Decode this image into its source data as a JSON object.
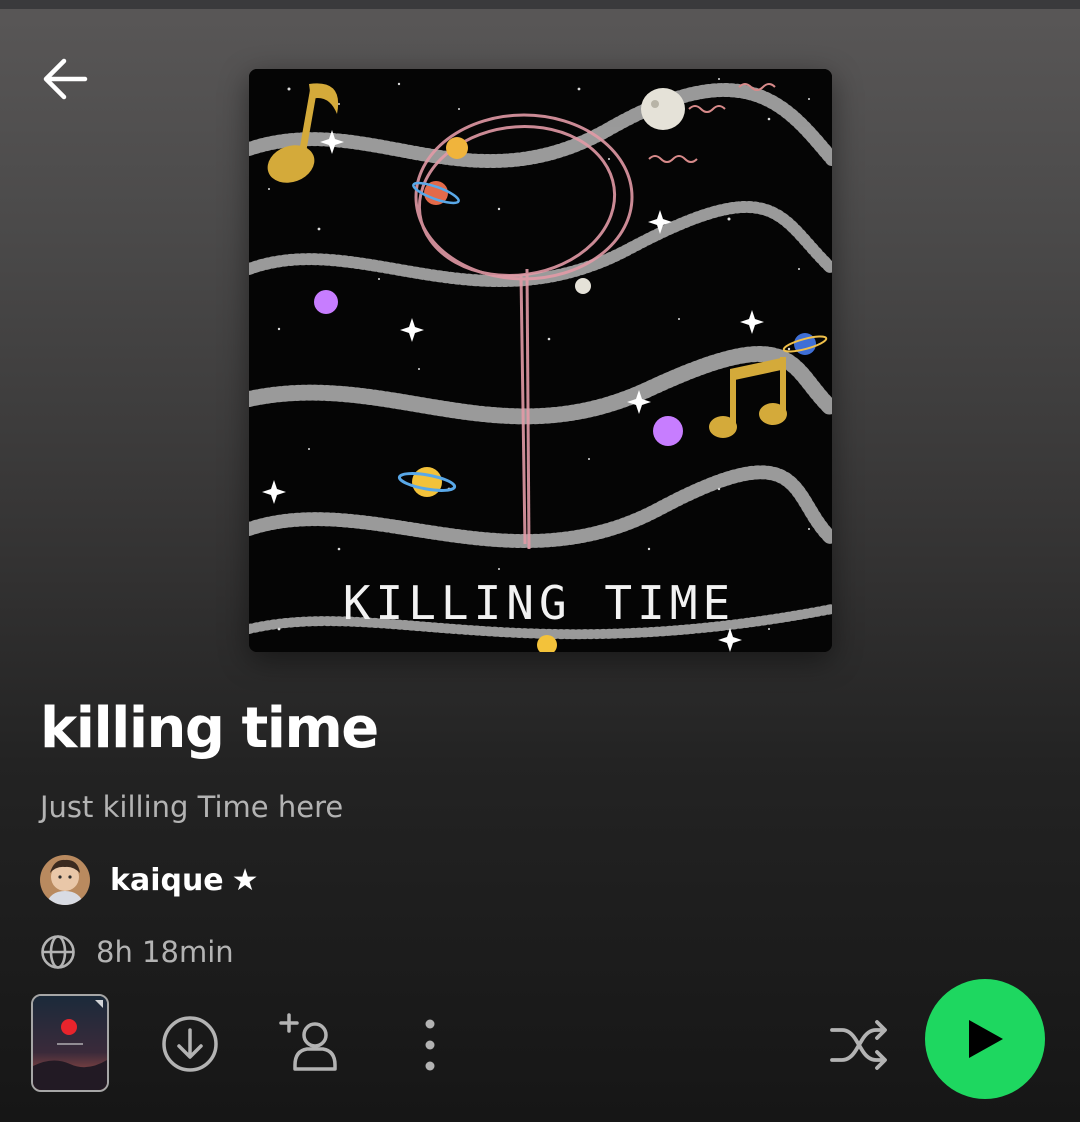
{
  "playlist": {
    "title": "killing time",
    "description": "Just killing Time here",
    "owner": "kaique",
    "owner_badge": "★",
    "duration": "8h 18min",
    "cover_text": "KILLING TIME"
  },
  "icons": {
    "back": "arrow-left-icon",
    "globe": "globe-icon",
    "download": "download-icon",
    "add_collaborator": "add-user-icon",
    "more": "more-vertical-icon",
    "shuffle": "shuffle-icon",
    "play": "play-icon"
  },
  "colors": {
    "accent": "#1ed760",
    "text_primary": "#ffffff",
    "text_secondary": "#b3b3b3"
  }
}
